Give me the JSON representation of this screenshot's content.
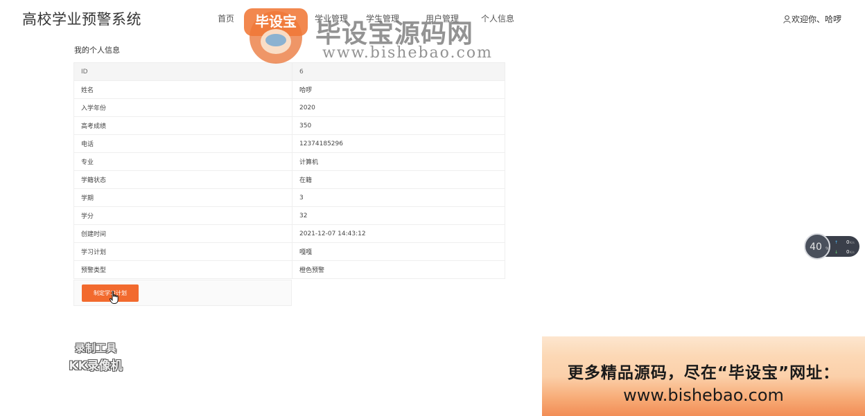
{
  "header": {
    "site_title": "高校学业预警系统",
    "nav": [
      "首页",
      "学业管理",
      "学生管理",
      "用户管理",
      "个人信息"
    ],
    "user_greeting": "欢迎你、哈啰"
  },
  "profile": {
    "section_title": "我的个人信息",
    "rows": [
      {
        "label": "ID",
        "value": "6"
      },
      {
        "label": "姓名",
        "value": "哈啰"
      },
      {
        "label": "入学年份",
        "value": "2020"
      },
      {
        "label": "高考成绩",
        "value": "350"
      },
      {
        "label": "电话",
        "value": "12374185296"
      },
      {
        "label": "专业",
        "value": "计算机"
      },
      {
        "label": "学籍状态",
        "value": "在籍"
      },
      {
        "label": "学期",
        "value": "3"
      },
      {
        "label": "学分",
        "value": "32"
      },
      {
        "label": "创建时间",
        "value": "2021-12-07 14:43:12"
      },
      {
        "label": "学习计划",
        "value": "嘎嘎"
      },
      {
        "label": "预警类型",
        "value": "橙色预警"
      }
    ],
    "plan_button_label": "制定学习计划"
  },
  "watermark": {
    "logo_text": "毕设宝",
    "brand": "毕设宝源码网",
    "url": "www.bishebao.com"
  },
  "recorder": {
    "line1": "录制工具",
    "line2": "KK录像机"
  },
  "speed_widget": {
    "percent": "40",
    "percent_unit": "%",
    "up": "0",
    "down": "0",
    "unit": "K/s"
  },
  "banner": {
    "line1": "更多精品源码，尽在“毕设宝”网址：",
    "line2": "www.bishebao.com"
  },
  "colors": {
    "accent": "#f26a2e"
  }
}
